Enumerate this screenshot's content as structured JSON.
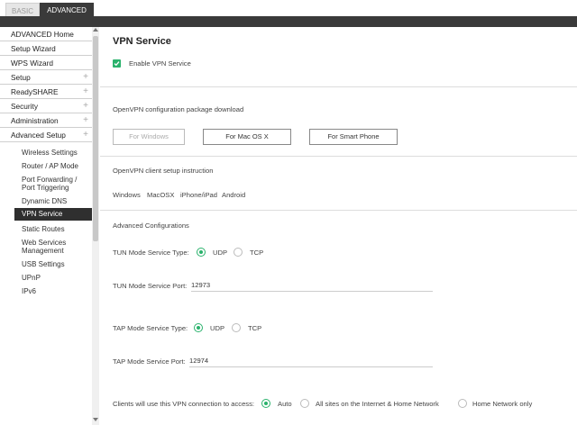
{
  "tabs": {
    "basic": "BASIC",
    "advanced": "ADVANCED"
  },
  "sidebar": {
    "main_items": [
      {
        "label": "ADVANCED Home",
        "plus": ""
      },
      {
        "label": "Setup Wizard",
        "plus": ""
      },
      {
        "label": "WPS Wizard",
        "plus": ""
      },
      {
        "label": "Setup",
        "plus": "+"
      },
      {
        "label": "ReadySHARE",
        "plus": "+"
      },
      {
        "label": "Security",
        "plus": "+"
      },
      {
        "label": "Administration",
        "plus": "+"
      },
      {
        "label": "Advanced Setup",
        "plus": "+"
      }
    ],
    "sub_items": [
      "Wireless Settings",
      "Router / AP Mode",
      "Port Forwarding /",
      "Port Triggering",
      "Dynamic DNS",
      "VPN Service",
      "Static Routes",
      "Web Services",
      "Management",
      "USB Settings",
      "UPnP",
      "IPv6"
    ]
  },
  "main": {
    "title": "VPN Service",
    "enable_label": "Enable VPN Service",
    "package_heading": "OpenVPN configuration package download",
    "buttons": {
      "windows": "For Windows",
      "mac": "For Mac OS X",
      "phone": "For Smart Phone"
    },
    "client_heading": "OpenVPN client setup instruction",
    "platforms": {
      "windows": "Windows",
      "mac": "MacOSX",
      "iphone": "iPhone/iPad",
      "android": "Android"
    },
    "advanced_heading": "Advanced Configurations",
    "tun_type_label": "TUN Mode Service Type:",
    "tun_port_label": "TUN Mode Service Port:",
    "tun_port_value": "12973",
    "tap_type_label": "TAP Mode Service Type:",
    "tap_port_label": "TAP Mode Service Port:",
    "tap_port_value": "12974",
    "udp": "UDP",
    "tcp": "TCP",
    "access_label": "Clients will use this VPN connection to access:",
    "access_auto": "Auto",
    "access_all": "All sites on the Internet & Home Network",
    "access_home": "Home Network only"
  },
  "colors": {
    "accent": "#2ab26c",
    "dark": "#3a3a3a"
  }
}
